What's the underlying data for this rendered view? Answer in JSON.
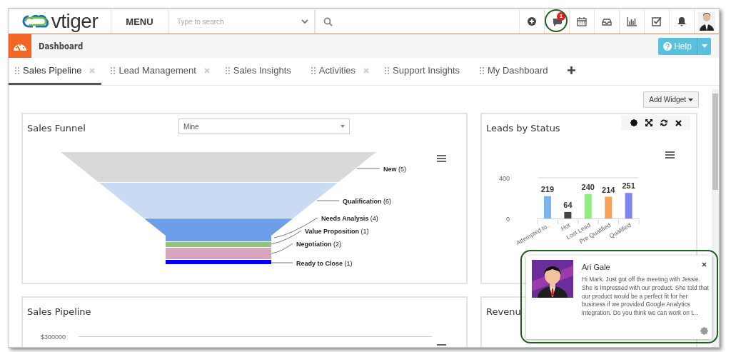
{
  "topbar": {
    "logo": "vtiger",
    "menu": "MENU",
    "search_placeholder": "Type to search",
    "chat_badge": "1"
  },
  "header": {
    "title": "Dashboard",
    "help": "Help"
  },
  "tabs": [
    {
      "label": "Sales Pipeline",
      "selected": true,
      "closable": true
    },
    {
      "label": "Lead Management",
      "selected": false,
      "closable": true
    },
    {
      "label": "Sales Insights",
      "selected": false,
      "closable": false
    },
    {
      "label": "Activities",
      "selected": false,
      "closable": true
    },
    {
      "label": "Support Insights",
      "selected": false,
      "closable": false
    },
    {
      "label": "My Dashboard",
      "selected": false,
      "closable": false
    }
  ],
  "add_widget": "Add Widget",
  "sales_funnel": {
    "title": "Sales Funnel",
    "filter": "Mine",
    "stages": [
      {
        "label": "New",
        "count": "(5)",
        "color": "#d9d9d9"
      },
      {
        "label": "Qualification",
        "count": "(6)",
        "color": "#c9daf5"
      },
      {
        "label": "Needs Analysis",
        "count": "(4)",
        "color": "#6d9eeb"
      },
      {
        "label": "Value Proposition",
        "count": "(1)",
        "color": "#93c47d"
      },
      {
        "label": "Negotiation",
        "count": "(2)",
        "color": "#d5a6bd"
      },
      {
        "label": "Ready to Close",
        "count": "(1)",
        "color": "#0000ff"
      }
    ]
  },
  "leads_by_status": {
    "title": "Leads by Status",
    "chart_data": {
      "type": "bar",
      "categories": [
        "Attempted to..",
        "Hot",
        "Lost Lead",
        "Pre Qualified",
        "Qualified"
      ],
      "values": [
        219,
        64,
        240,
        214,
        251
      ],
      "colors": [
        "#7cb5ec",
        "#434348",
        "#90ed7d",
        "#f7a35c",
        "#8085e9"
      ],
      "ylim": [
        0,
        400
      ],
      "yticks": [
        0,
        400
      ],
      "data_labels": true
    }
  },
  "sales_pipeline": {
    "title": "Sales Pipeline",
    "y_tick": "$300000"
  },
  "revenue": {
    "title": "Revenu"
  },
  "notification": {
    "sender": "Ari Gale",
    "message": "Hi Mark. Just got off the meeting with Jessie. She is impressed with our product. She told that our product would be a perfect fit for her business if we provided Google Analytics integration. Do you think we can work on t..."
  }
}
